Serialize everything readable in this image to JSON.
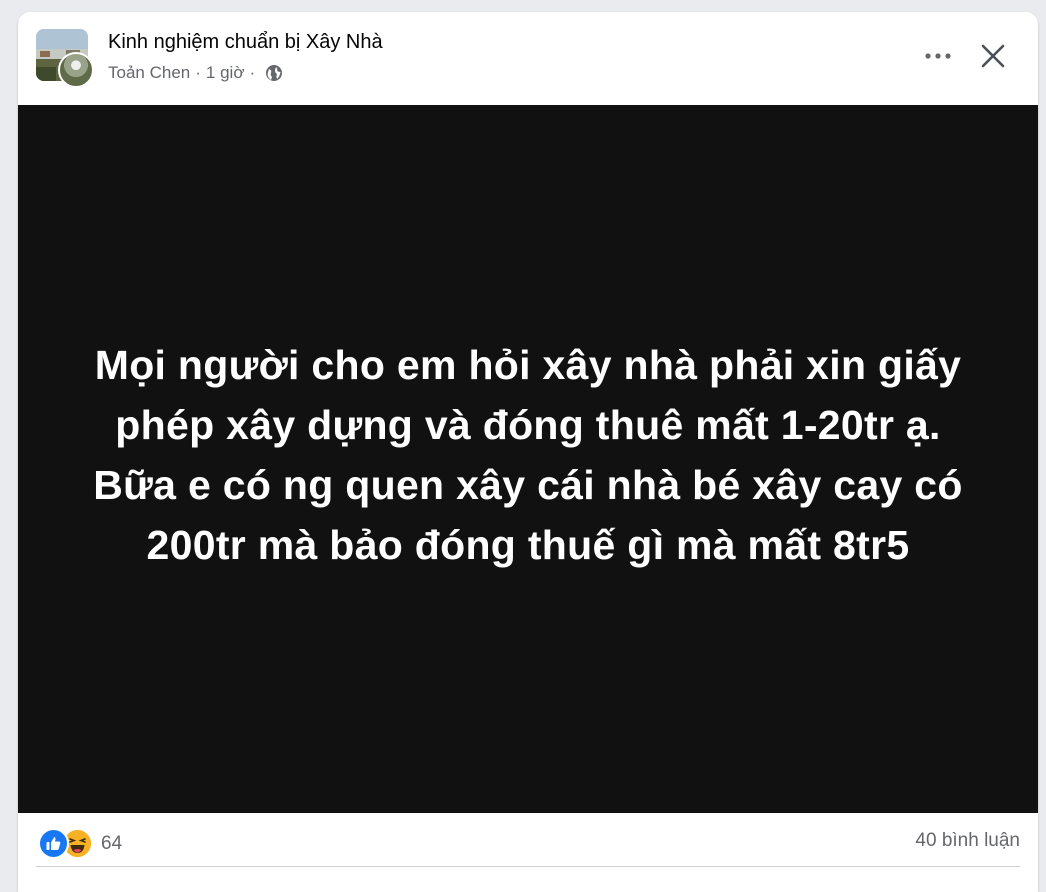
{
  "post": {
    "group_name": "Kinh nghiệm chuẩn bị Xây Nhà",
    "author": "Toản Chen",
    "time": "1 giờ",
    "separator": "·",
    "privacy_icon": "globe-icon",
    "text_lines": [
      "Mọi người cho em hỏi xây nhà phải xin giấy",
      "phép xây dựng và đóng thuê mất 1-20tr ạ.",
      "Bữa e có ng quen xây cái nhà bé xây cay có",
      "200tr mà bảo đóng thuế gì mà mất 8tr5"
    ],
    "background_color": "#111111",
    "text_color": "#ffffff"
  },
  "footer": {
    "reaction_icons": [
      "like-icon",
      "haha-icon"
    ],
    "reaction_count": "64",
    "comment_count": "40 bình luận"
  },
  "colors": {
    "like_blue": "#1877f2",
    "haha_yellow": "#f7b125",
    "meta_gray": "#65676b"
  }
}
